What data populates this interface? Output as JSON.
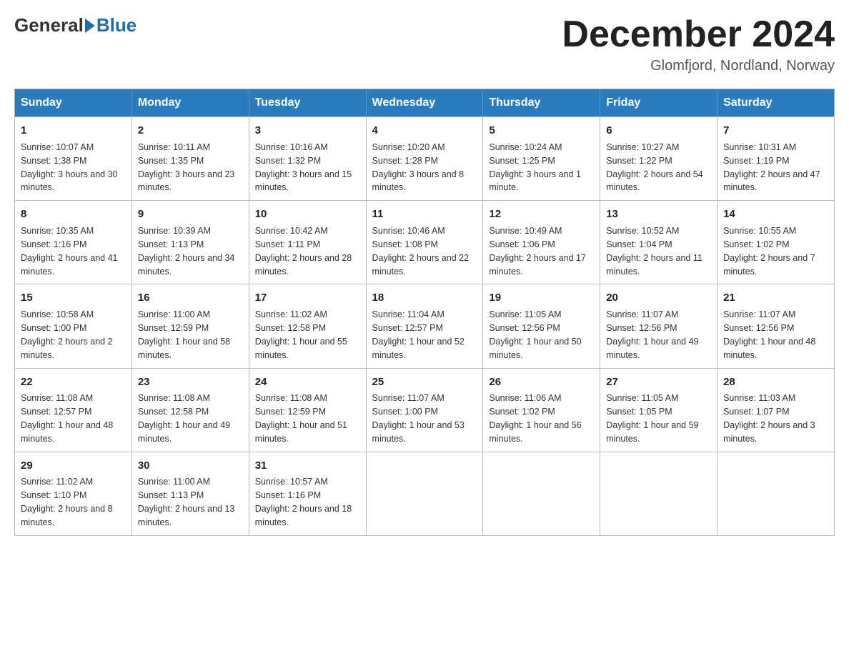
{
  "header": {
    "logo_general": "General",
    "logo_blue": "Blue",
    "month_title": "December 2024",
    "location": "Glomfjord, Nordland, Norway"
  },
  "days_of_week": [
    "Sunday",
    "Monday",
    "Tuesday",
    "Wednesday",
    "Thursday",
    "Friday",
    "Saturday"
  ],
  "weeks": [
    [
      {
        "day": "1",
        "sunrise": "Sunrise: 10:07 AM",
        "sunset": "Sunset: 1:38 PM",
        "daylight": "Daylight: 3 hours and 30 minutes."
      },
      {
        "day": "2",
        "sunrise": "Sunrise: 10:11 AM",
        "sunset": "Sunset: 1:35 PM",
        "daylight": "Daylight: 3 hours and 23 minutes."
      },
      {
        "day": "3",
        "sunrise": "Sunrise: 10:16 AM",
        "sunset": "Sunset: 1:32 PM",
        "daylight": "Daylight: 3 hours and 15 minutes."
      },
      {
        "day": "4",
        "sunrise": "Sunrise: 10:20 AM",
        "sunset": "Sunset: 1:28 PM",
        "daylight": "Daylight: 3 hours and 8 minutes."
      },
      {
        "day": "5",
        "sunrise": "Sunrise: 10:24 AM",
        "sunset": "Sunset: 1:25 PM",
        "daylight": "Daylight: 3 hours and 1 minute."
      },
      {
        "day": "6",
        "sunrise": "Sunrise: 10:27 AM",
        "sunset": "Sunset: 1:22 PM",
        "daylight": "Daylight: 2 hours and 54 minutes."
      },
      {
        "day": "7",
        "sunrise": "Sunrise: 10:31 AM",
        "sunset": "Sunset: 1:19 PM",
        "daylight": "Daylight: 2 hours and 47 minutes."
      }
    ],
    [
      {
        "day": "8",
        "sunrise": "Sunrise: 10:35 AM",
        "sunset": "Sunset: 1:16 PM",
        "daylight": "Daylight: 2 hours and 41 minutes."
      },
      {
        "day": "9",
        "sunrise": "Sunrise: 10:39 AM",
        "sunset": "Sunset: 1:13 PM",
        "daylight": "Daylight: 2 hours and 34 minutes."
      },
      {
        "day": "10",
        "sunrise": "Sunrise: 10:42 AM",
        "sunset": "Sunset: 1:11 PM",
        "daylight": "Daylight: 2 hours and 28 minutes."
      },
      {
        "day": "11",
        "sunrise": "Sunrise: 10:46 AM",
        "sunset": "Sunset: 1:08 PM",
        "daylight": "Daylight: 2 hours and 22 minutes."
      },
      {
        "day": "12",
        "sunrise": "Sunrise: 10:49 AM",
        "sunset": "Sunset: 1:06 PM",
        "daylight": "Daylight: 2 hours and 17 minutes."
      },
      {
        "day": "13",
        "sunrise": "Sunrise: 10:52 AM",
        "sunset": "Sunset: 1:04 PM",
        "daylight": "Daylight: 2 hours and 11 minutes."
      },
      {
        "day": "14",
        "sunrise": "Sunrise: 10:55 AM",
        "sunset": "Sunset: 1:02 PM",
        "daylight": "Daylight: 2 hours and 7 minutes."
      }
    ],
    [
      {
        "day": "15",
        "sunrise": "Sunrise: 10:58 AM",
        "sunset": "Sunset: 1:00 PM",
        "daylight": "Daylight: 2 hours and 2 minutes."
      },
      {
        "day": "16",
        "sunrise": "Sunrise: 11:00 AM",
        "sunset": "Sunset: 12:59 PM",
        "daylight": "Daylight: 1 hour and 58 minutes."
      },
      {
        "day": "17",
        "sunrise": "Sunrise: 11:02 AM",
        "sunset": "Sunset: 12:58 PM",
        "daylight": "Daylight: 1 hour and 55 minutes."
      },
      {
        "day": "18",
        "sunrise": "Sunrise: 11:04 AM",
        "sunset": "Sunset: 12:57 PM",
        "daylight": "Daylight: 1 hour and 52 minutes."
      },
      {
        "day": "19",
        "sunrise": "Sunrise: 11:05 AM",
        "sunset": "Sunset: 12:56 PM",
        "daylight": "Daylight: 1 hour and 50 minutes."
      },
      {
        "day": "20",
        "sunrise": "Sunrise: 11:07 AM",
        "sunset": "Sunset: 12:56 PM",
        "daylight": "Daylight: 1 hour and 49 minutes."
      },
      {
        "day": "21",
        "sunrise": "Sunrise: 11:07 AM",
        "sunset": "Sunset: 12:56 PM",
        "daylight": "Daylight: 1 hour and 48 minutes."
      }
    ],
    [
      {
        "day": "22",
        "sunrise": "Sunrise: 11:08 AM",
        "sunset": "Sunset: 12:57 PM",
        "daylight": "Daylight: 1 hour and 48 minutes."
      },
      {
        "day": "23",
        "sunrise": "Sunrise: 11:08 AM",
        "sunset": "Sunset: 12:58 PM",
        "daylight": "Daylight: 1 hour and 49 minutes."
      },
      {
        "day": "24",
        "sunrise": "Sunrise: 11:08 AM",
        "sunset": "Sunset: 12:59 PM",
        "daylight": "Daylight: 1 hour and 51 minutes."
      },
      {
        "day": "25",
        "sunrise": "Sunrise: 11:07 AM",
        "sunset": "Sunset: 1:00 PM",
        "daylight": "Daylight: 1 hour and 53 minutes."
      },
      {
        "day": "26",
        "sunrise": "Sunrise: 11:06 AM",
        "sunset": "Sunset: 1:02 PM",
        "daylight": "Daylight: 1 hour and 56 minutes."
      },
      {
        "day": "27",
        "sunrise": "Sunrise: 11:05 AM",
        "sunset": "Sunset: 1:05 PM",
        "daylight": "Daylight: 1 hour and 59 minutes."
      },
      {
        "day": "28",
        "sunrise": "Sunrise: 11:03 AM",
        "sunset": "Sunset: 1:07 PM",
        "daylight": "Daylight: 2 hours and 3 minutes."
      }
    ],
    [
      {
        "day": "29",
        "sunrise": "Sunrise: 11:02 AM",
        "sunset": "Sunset: 1:10 PM",
        "daylight": "Daylight: 2 hours and 8 minutes."
      },
      {
        "day": "30",
        "sunrise": "Sunrise: 11:00 AM",
        "sunset": "Sunset: 1:13 PM",
        "daylight": "Daylight: 2 hours and 13 minutes."
      },
      {
        "day": "31",
        "sunrise": "Sunrise: 10:57 AM",
        "sunset": "Sunset: 1:16 PM",
        "daylight": "Daylight: 2 hours and 18 minutes."
      },
      null,
      null,
      null,
      null
    ]
  ]
}
